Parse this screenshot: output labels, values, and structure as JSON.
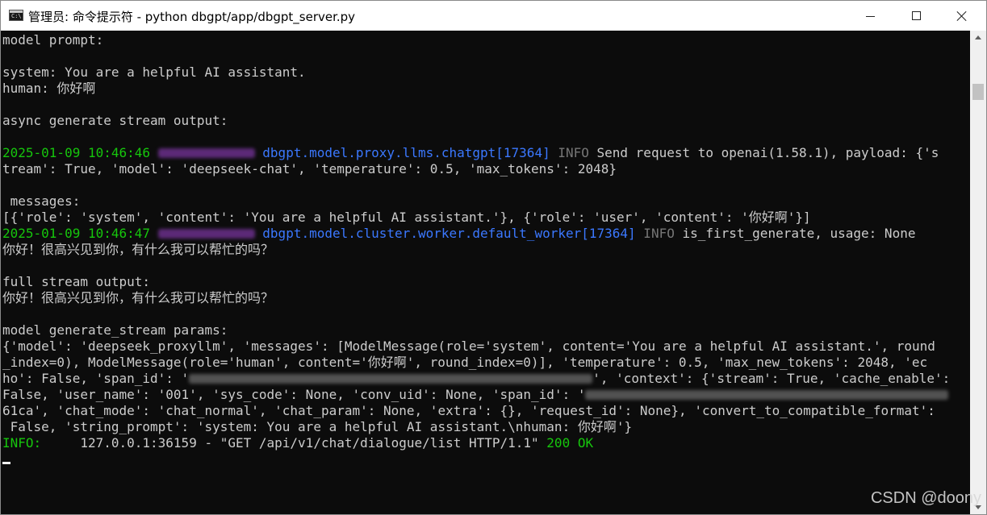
{
  "window": {
    "title": "管理员: 命令提示符 - python  dbgpt/app/dbgpt_server.py",
    "icon": "cmd-icon"
  },
  "console": {
    "lines": [
      [
        {
          "t": "model prompt:",
          "c": "white"
        }
      ],
      [],
      [
        {
          "t": "system: You are a helpful AI assistant.",
          "c": "white"
        }
      ],
      [
        {
          "t": "human: 你好啊",
          "c": "white"
        }
      ],
      [],
      [
        {
          "t": "async generate stream output:",
          "c": "white"
        }
      ],
      [],
      [
        {
          "t": "2025-01-09 10:46:46 ",
          "c": "green"
        },
        {
          "blur": "purple",
          "w": 120
        },
        {
          "t": " dbgpt.model.proxy.llms.chatgpt[17364]",
          "c": "blue"
        },
        {
          "t": " INFO",
          "c": "gray"
        },
        {
          "t": " Send request to openai(1.58.1), payload: {'s",
          "c": "white"
        }
      ],
      [
        {
          "t": "tream': True, 'model': 'deepseek-chat', 'temperature': 0.5, 'max_tokens': 2048}",
          "c": "white"
        }
      ],
      [],
      [
        {
          "t": " messages:",
          "c": "white"
        }
      ],
      [
        {
          "t": "[{'role': 'system', 'content': 'You are a helpful AI assistant.'}, {'role': 'user', 'content': '你好啊'}]",
          "c": "white"
        }
      ],
      [
        {
          "t": "2025-01-09 10:46:47 ",
          "c": "green"
        },
        {
          "blur": "purple",
          "w": 120
        },
        {
          "t": " dbgpt.model.cluster.worker.default_worker[17364]",
          "c": "blue"
        },
        {
          "t": " INFO",
          "c": "gray"
        },
        {
          "t": " is_first_generate, usage: None",
          "c": "white"
        }
      ],
      [
        {
          "t": "你好！很高兴见到你，有什么我可以帮忙的吗？",
          "c": "white"
        }
      ],
      [],
      [
        {
          "t": "full stream output:",
          "c": "white"
        }
      ],
      [
        {
          "t": "你好！很高兴见到你，有什么我可以帮忙的吗？",
          "c": "white"
        }
      ],
      [],
      [
        {
          "t": "model generate_stream params:",
          "c": "white"
        }
      ],
      [
        {
          "t": "{'model': 'deepseek_proxyllm', 'messages': [ModelMessage(role='system', content='You are a helpful AI assistant.', round",
          "c": "white"
        }
      ],
      [
        {
          "t": "_index=0), ModelMessage(role='human', content='你好啊', round_index=0)], 'temperature': 0.5, 'max_new_tokens': 2048, 'ec",
          "c": "white"
        }
      ],
      [
        {
          "t": "ho': False, 'span_id': '",
          "c": "white"
        },
        {
          "blur": "grayb",
          "w": 500
        },
        {
          "t": "', 'context': {'stream': True, 'cache_enable':",
          "c": "white"
        }
      ],
      [
        {
          "t": "False, 'user_name': '001', 'sys_code': None, 'conv_uid': None, 'span_id': '",
          "c": "white"
        },
        {
          "blur": "grayb",
          "w": 450
        }
      ],
      [
        {
          "t": "61ca', 'chat_mode': 'chat_normal', 'chat_param': None, 'extra': {}, 'request_id': None}, 'convert_to_compatible_format':",
          "c": "white"
        }
      ],
      [
        {
          "t": " False, 'string_prompt': 'system: You are a helpful AI assistant.\\nhuman: 你好啊'}",
          "c": "white"
        }
      ],
      [
        {
          "t": "INFO:     ",
          "c": "green"
        },
        {
          "t": "127.0.0.1:36159 - \"GET /api/v1/chat/dialogue/list HTTP/1.1\" ",
          "c": "white"
        },
        {
          "t": "200 OK",
          "c": "green"
        }
      ]
    ]
  },
  "watermark": "CSDN @doony",
  "colors": {
    "console_bg": "#0c0c0c",
    "text": "#cccccc",
    "green": "#16c60c",
    "blue": "#3b78ff",
    "gray": "#767676"
  }
}
